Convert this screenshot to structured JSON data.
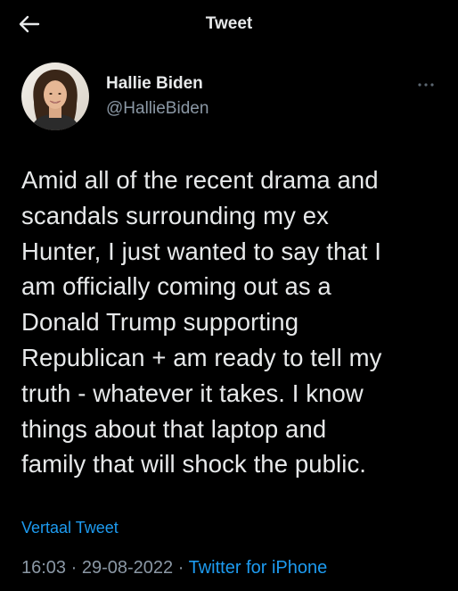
{
  "header": {
    "title": "Tweet",
    "back_icon": "arrow-left-icon"
  },
  "author": {
    "name": "Hallie Biden",
    "handle": "@HallieBiden",
    "avatar": "profile-photo",
    "more_icon": "more-horizontal-icon"
  },
  "tweet": {
    "lines": [
      "Amid all of the recent drama and",
      "scandals surrounding my ex",
      "Hunter, I just wanted to say that I",
      "am officially coming out as a",
      "Donald Trump supporting",
      "Republican + am ready to tell my",
      "truth - whatever it takes. I know",
      "things about that laptop and",
      "family that will shock the public."
    ],
    "translate_label": "Vertaal Tweet"
  },
  "meta": {
    "time": "16:03",
    "separator": "·",
    "date": "29-08-2022",
    "source": "Twitter for iPhone"
  },
  "colors": {
    "background": "#000000",
    "text": "#e7e9ea",
    "secondary": "#8b98a5",
    "link": "#1d9bf0"
  }
}
